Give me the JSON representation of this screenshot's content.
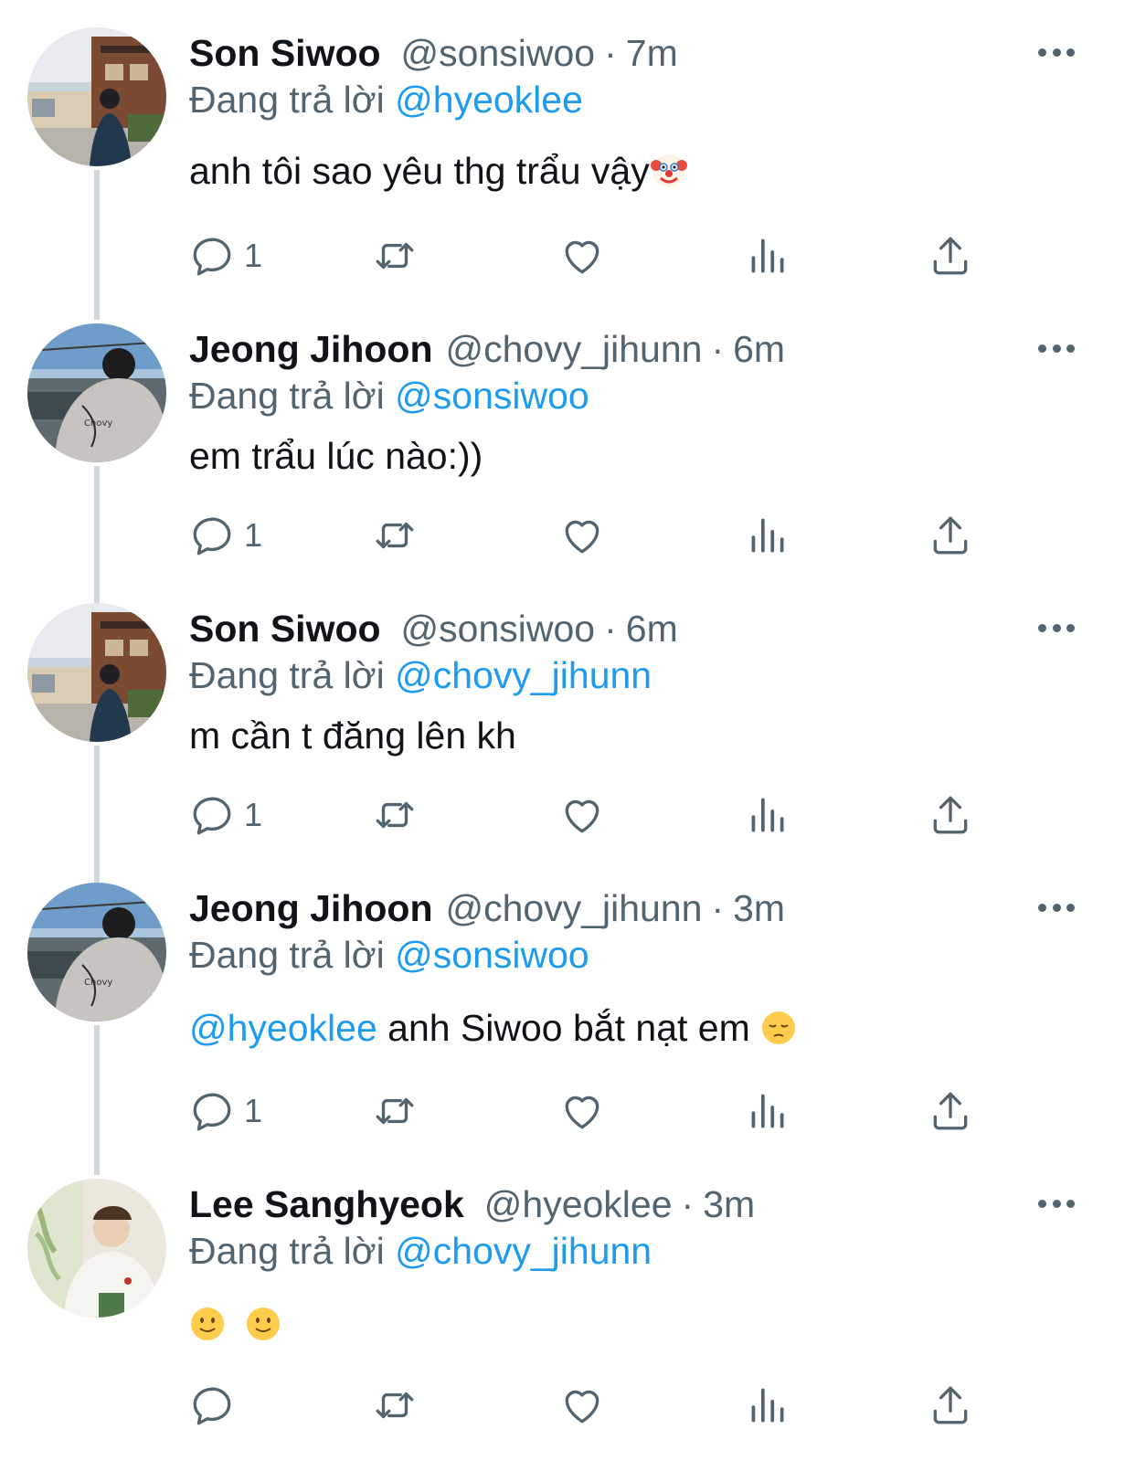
{
  "thread": {
    "tweets": [
      {
        "display_name": "Son Siwoo",
        "handle": "@sonsiwoo",
        "separator": "·",
        "time": "7m",
        "replying_prefix": "Đang trả lời",
        "replying_to": "@hyeoklee",
        "text": "anh tôi sao yêu thg trẩu vậy",
        "text_emoji": "clown-face",
        "reply_count": "1",
        "avatar": "boy-at-wooden-house-photo"
      },
      {
        "display_name": "Jeong Jihoon",
        "handle": "@chovy_jihunn",
        "separator": "·",
        "time": "6m",
        "replying_prefix": "Đang trả lời",
        "replying_to": "@sonsiwoo",
        "text": "em trẩu lúc nào:))",
        "reply_count": "1",
        "avatar": "boy-at-train-station-photo"
      },
      {
        "display_name": "Son Siwoo",
        "handle": "@sonsiwoo",
        "separator": "·",
        "time": "6m",
        "replying_prefix": "Đang trả lời",
        "replying_to": "@chovy_jihunn",
        "text": "m cần t đăng lên kh",
        "reply_count": "1",
        "avatar": "boy-at-wooden-house-photo"
      },
      {
        "display_name": "Jeong Jihoon",
        "handle": "@chovy_jihunn",
        "separator": "·",
        "time": "3m",
        "replying_prefix": "Đang trả lời",
        "replying_to": "@sonsiwoo",
        "text_mention": "@hyeoklee",
        "text": " anh Siwoo bắt nạt em ",
        "text_emoji": "pensive-face",
        "reply_count": "1",
        "avatar": "boy-at-train-station-photo"
      },
      {
        "display_name": "Lee Sanghyeok",
        "handle": "@hyeoklee",
        "separator": "·",
        "time": "3m",
        "replying_prefix": "Đang trả lời",
        "replying_to": "@chovy_jihunn",
        "text_emoji": "slightly-smiling-face x2",
        "reply_count": "",
        "avatar": "man-in-white-sweater-photo"
      }
    ]
  },
  "colors": {
    "text": "#0f1419",
    "secondary": "#536471",
    "accent": "#1d9bf0",
    "thread_line": "#cfd9de"
  },
  "icons": [
    "reply-icon",
    "retweet-icon",
    "like-icon",
    "views-icon",
    "share-icon",
    "more-icon"
  ]
}
